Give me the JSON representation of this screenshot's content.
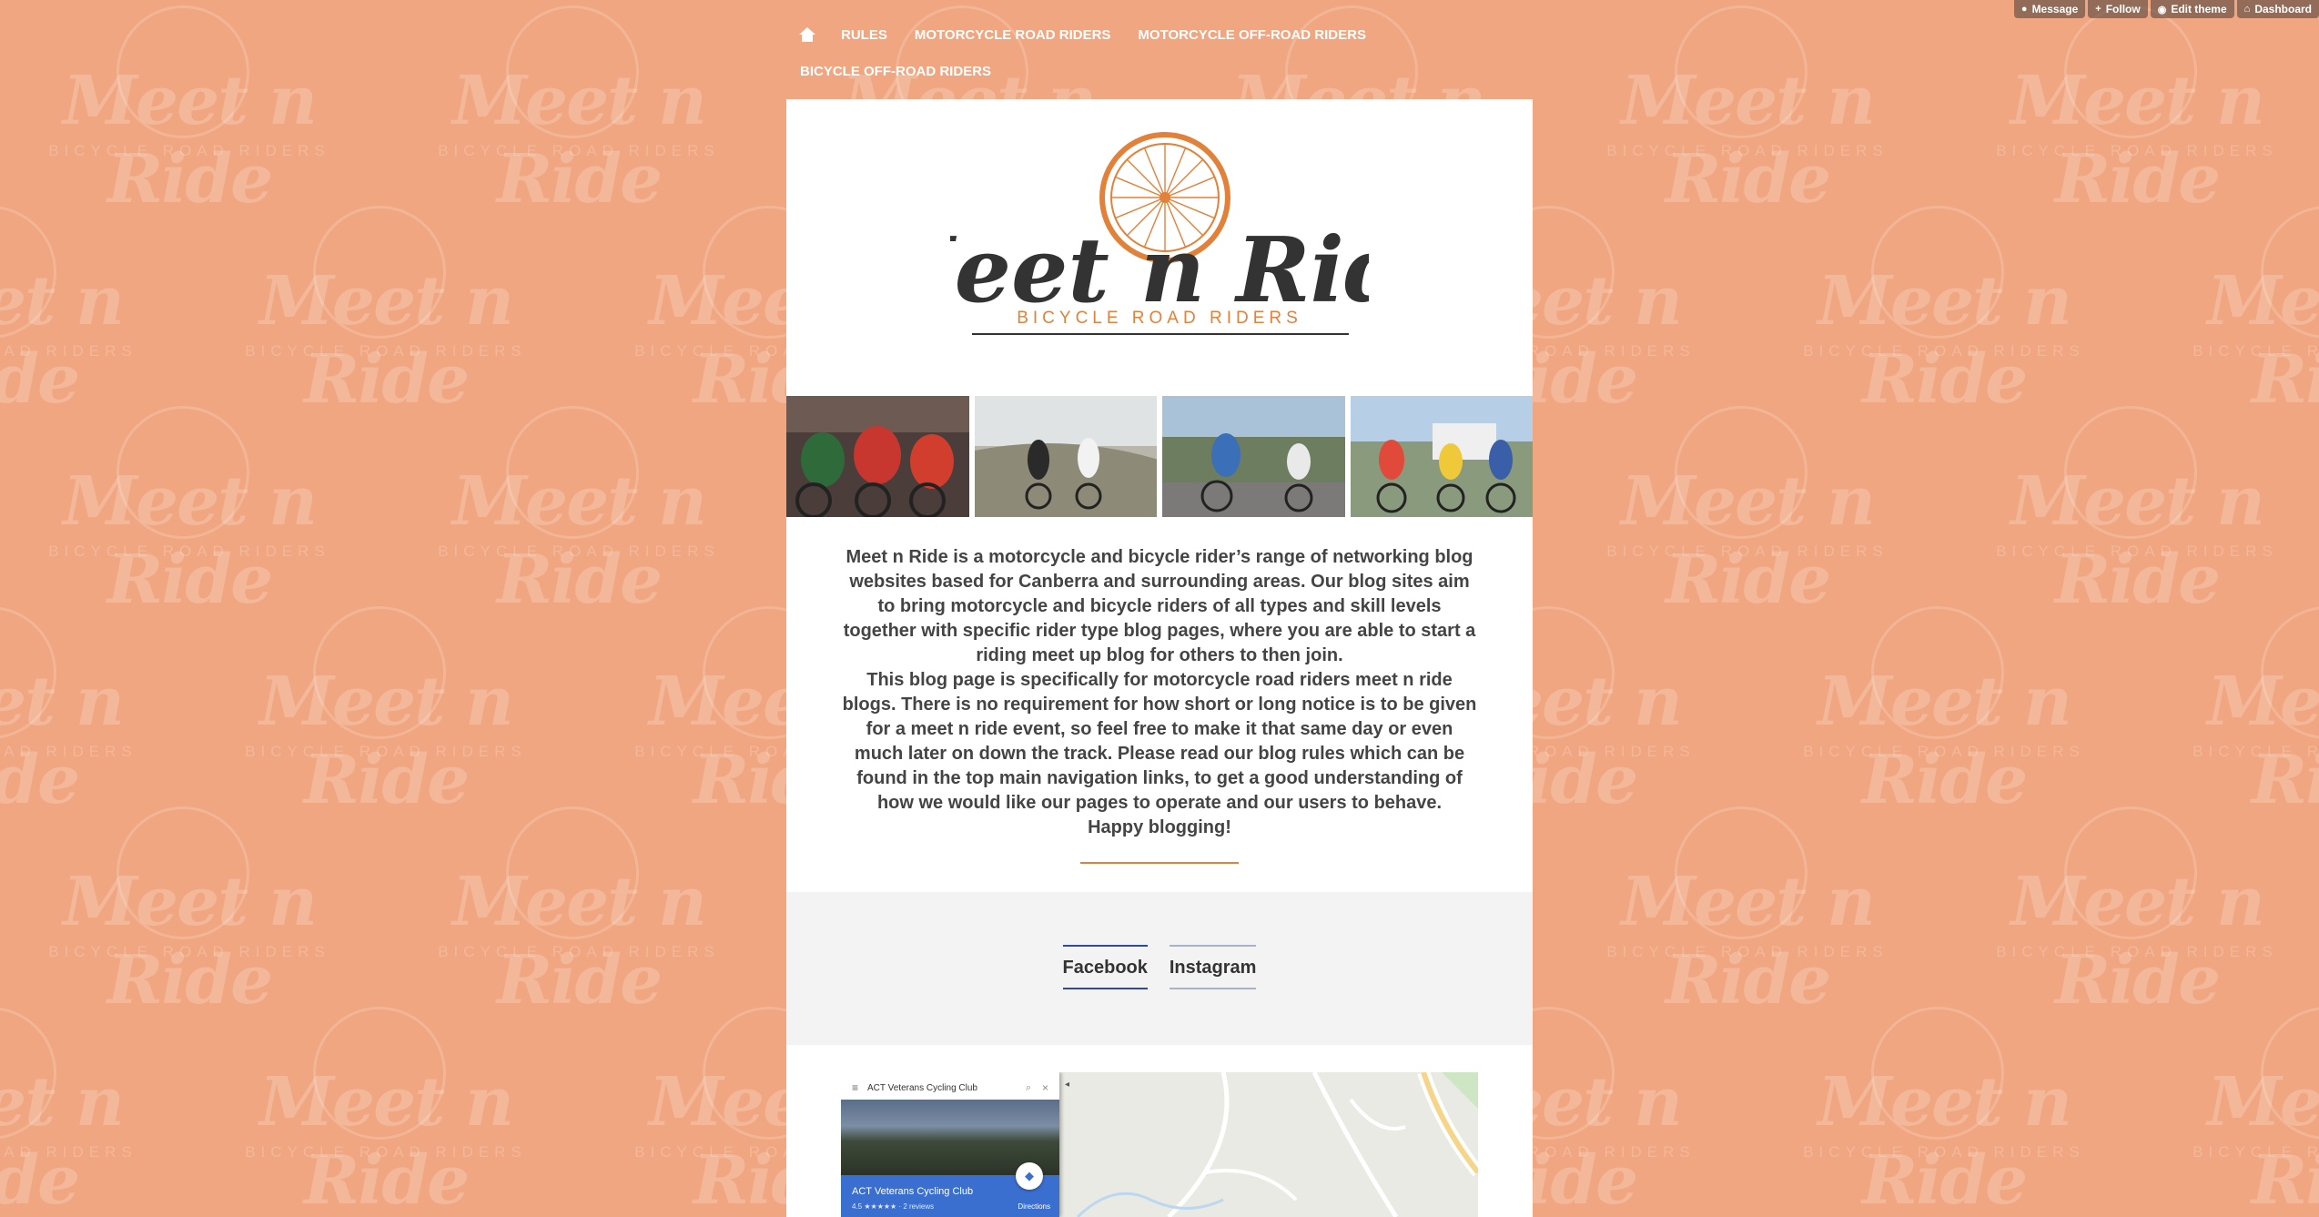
{
  "controls": {
    "message": "Message",
    "follow": "Follow",
    "edit_theme": "Edit theme",
    "dashboard": "Dashboard"
  },
  "nav": {
    "items": [
      "RULES",
      "MOTORCYCLE ROAD RIDERS",
      "MOTORCYCLE OFF-ROAD RIDERS",
      "BICYCLE OFF-ROAD RIDERS"
    ]
  },
  "logo": {
    "title": "Meet n Ride",
    "subtitle": "BICYCLE ROAD RIDERS",
    "accent": "#e2813a",
    "text_color": "#333333"
  },
  "about": {
    "p1": "Meet n Ride is a motorcycle and bicycle rider’s range of networking blog websites based for Canberra and surrounding areas. Our blog sites aim to bring motorcycle and bicycle riders of all types and skill levels together with specific rider type blog pages, where you are able to start a riding meet up blog for others to then join.",
    "p2": "This blog page is specifically for motorcycle road riders meet n ride blogs. There is no requirement for how short or long notice is to be given for a meet n ride event, so feel free to make it that same day or even much later on down the track. Please read our blog rules which can be found in the top main navigation links, to get a good understanding of how we would like our pages to operate and our users to behave.",
    "p3": "Happy blogging!"
  },
  "social": {
    "tabs": [
      "Facebook",
      "Instagram"
    ],
    "active": "Facebook"
  },
  "map": {
    "search": "ACT Veterans Cycling Club",
    "place_name": "ACT Veterans Cycling Club",
    "rating": "4.5 ★★★★★ · 2 reviews",
    "directions": "Directions"
  },
  "colors": {
    "background": "#f0a680",
    "active_tab": "#2e4a9e",
    "divider": "#e2813a"
  }
}
